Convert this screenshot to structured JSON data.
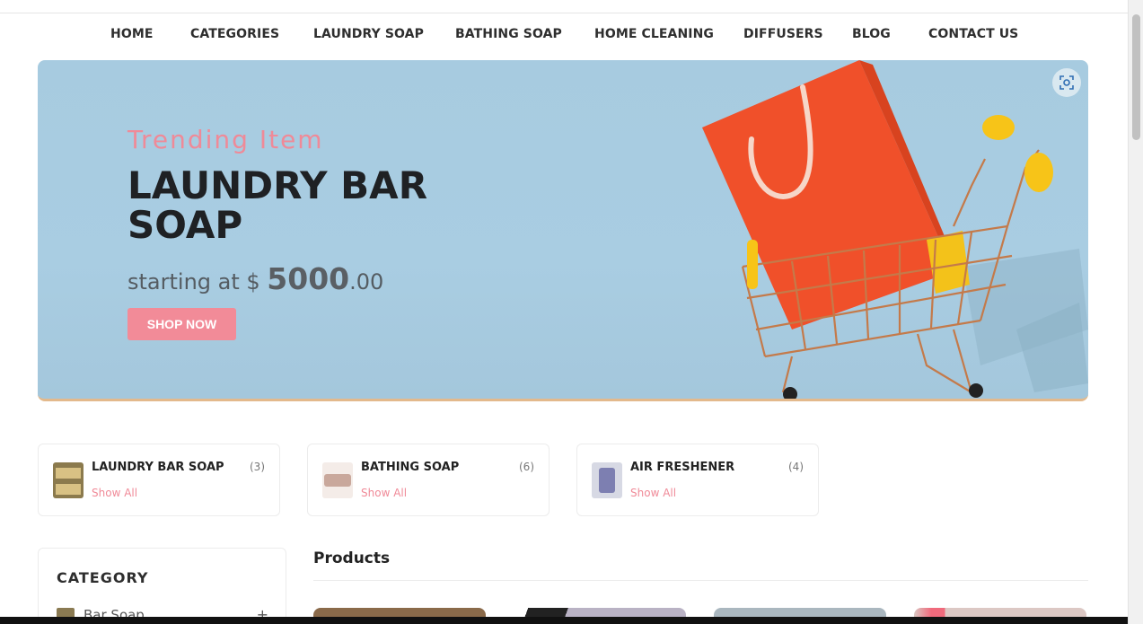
{
  "nav": {
    "items": [
      "HOME",
      "CATEGORIES",
      "LAUNDRY SOAP",
      "BATHING SOAP",
      "HOME CLEANING",
      "DIFFUSERS",
      "BLOG",
      "CONTACT US"
    ]
  },
  "hero": {
    "eyebrow": "Trending Item",
    "title": "LAUNDRY BAR SOAP",
    "price_prefix": "starting at $",
    "price_main": "5000",
    "price_cents": ".00",
    "button": "SHOP NOW",
    "lens_icon": "visual-search-icon"
  },
  "categories": [
    {
      "name": "LAUNDRY BAR SOAP",
      "count": "(3)",
      "link": "Show All"
    },
    {
      "name": "BATHING SOAP",
      "count": "(6)",
      "link": "Show All"
    },
    {
      "name": "AIR FRESHENER",
      "count": "(4)",
      "link": "Show All"
    }
  ],
  "sidebar": {
    "title": "CATEGORY",
    "items": [
      {
        "label": "Bar Soap",
        "toggle": "+"
      }
    ]
  },
  "products": {
    "title": "Products"
  },
  "colors": {
    "accent": "#f28b98",
    "hero_bg": "#a7cbe0",
    "text_dark": "#1f2124"
  }
}
